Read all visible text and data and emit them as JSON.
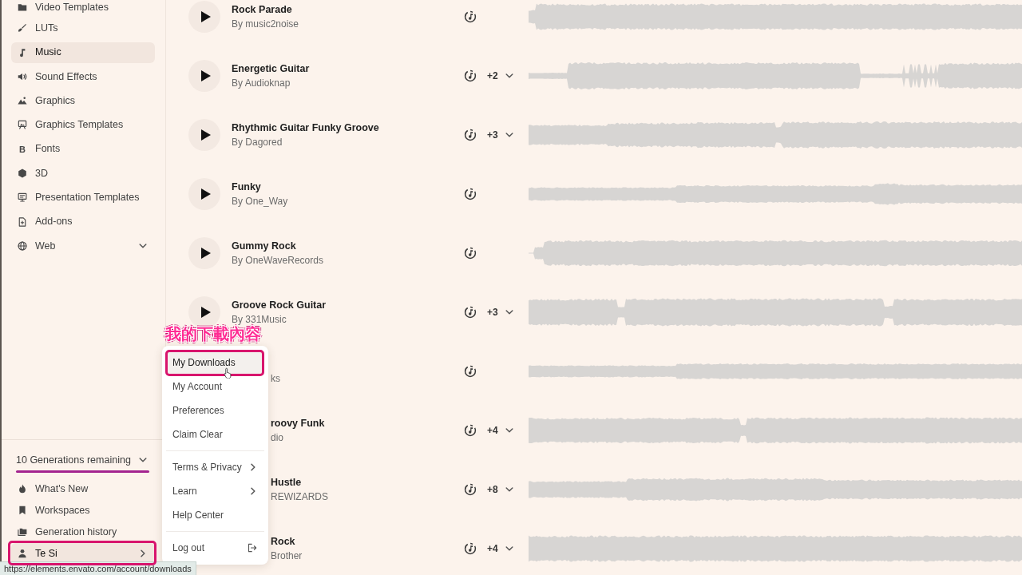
{
  "sidebar": {
    "items": [
      {
        "label": "Video Templates",
        "kind": "link",
        "selected": false
      },
      {
        "label": "LUTs",
        "kind": "link",
        "selected": false
      },
      {
        "label": "Music",
        "kind": "link",
        "selected": true
      },
      {
        "label": "Sound Effects",
        "kind": "link",
        "selected": false
      },
      {
        "label": "Graphics",
        "kind": "link",
        "selected": false
      },
      {
        "label": "Graphics Templates",
        "kind": "link",
        "selected": false
      },
      {
        "label": "Fonts",
        "kind": "link",
        "selected": false,
        "glyph": "B"
      },
      {
        "label": "3D",
        "kind": "link",
        "selected": false
      },
      {
        "label": "Presentation Templates",
        "kind": "link",
        "selected": false
      },
      {
        "label": "Add-ons",
        "kind": "link",
        "selected": false
      },
      {
        "label": "Web",
        "kind": "group",
        "selected": false
      }
    ],
    "generations": {
      "label": "10 Generations remaining",
      "underlined": true
    },
    "links": [
      {
        "label": "What's New"
      },
      {
        "label": "Workspaces"
      },
      {
        "label": "Generation history"
      }
    ],
    "user": {
      "name": "Te Si",
      "expanded": true,
      "highlighted": true
    }
  },
  "tracks": [
    {
      "kind": "full",
      "title": "Rock Parade",
      "byline": "By music2noise"
    },
    {
      "kind": "full",
      "title": "Energetic Guitar",
      "byline": "By Audioknap",
      "count": "+2"
    },
    {
      "kind": "full",
      "title": "Rhythmic Guitar Funky Groove",
      "byline": "By Dagored",
      "count": "+3"
    },
    {
      "kind": "full",
      "title": "Funky",
      "byline": "By One_Way"
    },
    {
      "kind": "full",
      "title": "Gummy Rock",
      "byline": "By OneWaveRecords"
    },
    {
      "kind": "full",
      "title": "Groove Rock Guitar",
      "byline": "By 331Music",
      "count": "+3"
    },
    {
      "kind": "partial",
      "byline": "ks"
    },
    {
      "kind": "partial",
      "title": "roovy Funk",
      "byline": "dio",
      "count": "+4"
    },
    {
      "kind": "partial",
      "title": "Hustle",
      "byline": "REWIZARDS",
      "count": "+8"
    },
    {
      "kind": "partial",
      "title": "Rock",
      "byline": "Brother",
      "count": "+4"
    }
  ],
  "annotation": {
    "label": "我的下載內容"
  },
  "user_menu": {
    "groups": [
      [
        {
          "label": "My Downloads",
          "kind": "link",
          "hovered": true,
          "highlighted": true
        },
        {
          "label": "My Account",
          "kind": "link",
          "hovered": false,
          "highlighted": false
        },
        {
          "label": "Preferences",
          "kind": "link",
          "hovered": false,
          "highlighted": false
        },
        {
          "label": "Claim Clear",
          "kind": "link",
          "hovered": false,
          "highlighted": false
        }
      ],
      [
        {
          "label": "Terms & Privacy",
          "kind": "submenu",
          "hovered": false,
          "highlighted": false
        },
        {
          "label": "Learn",
          "kind": "submenu",
          "hovered": false,
          "highlighted": false
        },
        {
          "label": "Help Center",
          "kind": "link",
          "hovered": false,
          "highlighted": false
        }
      ],
      [
        {
          "label": "Log out",
          "kind": "action",
          "hovered": false,
          "highlighted": false
        }
      ]
    ]
  },
  "status_bar": {
    "url": "https://elements.envato.com/account/downloads"
  }
}
